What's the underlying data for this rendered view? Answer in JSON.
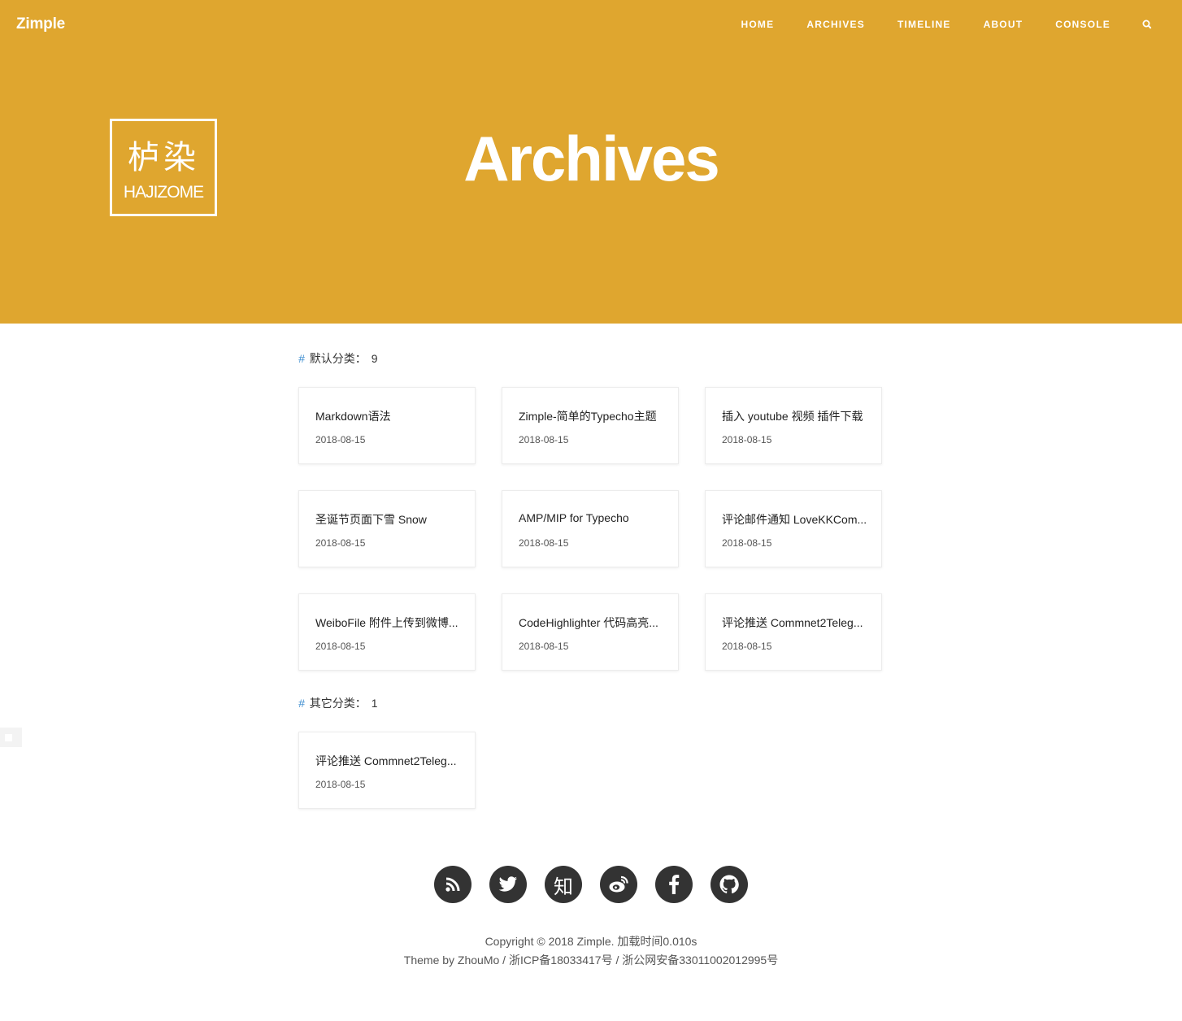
{
  "header": {
    "brand": "Zimple",
    "nav": [
      "HOME",
      "ARCHIVES",
      "TIMELINE",
      "ABOUT",
      "CONSOLE"
    ],
    "search_icon": "search-icon"
  },
  "hero": {
    "logo_cn": "栌染",
    "logo_en": "HAJIZOME",
    "title": "Archives",
    "background": "#dfa62f"
  },
  "categories": [
    {
      "hash": "#",
      "name": "默认分类：",
      "count": "9",
      "posts": [
        {
          "title": "Markdown语法",
          "date": "2018-08-15"
        },
        {
          "title": "Zimple-简单的Typecho主题",
          "date": "2018-08-15"
        },
        {
          "title": "插入 youtube 视频 插件下载",
          "date": "2018-08-15"
        },
        {
          "title": "圣诞节页面下雪 Snow",
          "date": "2018-08-15"
        },
        {
          "title": "AMP/MIP for Typecho",
          "date": "2018-08-15"
        },
        {
          "title": "评论邮件通知 LoveKKCom...",
          "date": "2018-08-15"
        },
        {
          "title": "WeiboFile 附件上传到微博...",
          "date": "2018-08-15"
        },
        {
          "title": "CodeHighlighter 代码高亮...",
          "date": "2018-08-15"
        },
        {
          "title": "评论推送 Commnet2Teleg...",
          "date": "2018-08-15"
        }
      ]
    },
    {
      "hash": "#",
      "name": "其它分类：",
      "count": "1",
      "posts": [
        {
          "title": "评论推送 Commnet2Teleg...",
          "date": "2018-08-15"
        }
      ]
    }
  ],
  "socials": [
    {
      "icon": "rss-icon"
    },
    {
      "icon": "twitter-icon"
    },
    {
      "icon": "zhihu-icon",
      "glyph": "知"
    },
    {
      "icon": "weibo-icon"
    },
    {
      "icon": "facebook-icon"
    },
    {
      "icon": "github-icon"
    }
  ],
  "footer": {
    "line1": "Copyright © 2018 Zimple. 加载时间0.010s",
    "line2": "Theme by ZhouMo / 浙ICP备18033417号 / 浙公网安备33011002012995号"
  }
}
